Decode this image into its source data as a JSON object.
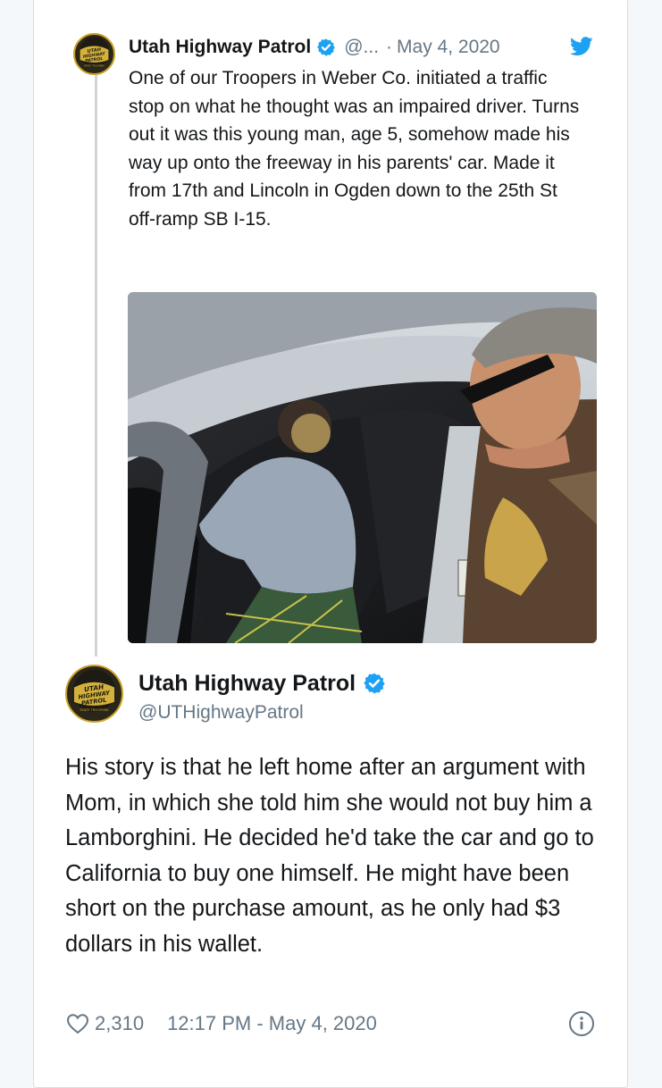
{
  "quoted_tweet": {
    "display_name": "Utah Highway Patrol",
    "handle": "@...",
    "separator": "·",
    "date": "May 4, 2020",
    "text": "One of our Troopers in Weber Co. initiated a traffic stop on what he thought was an impaired driver. Turns out it was this young man, age 5, somehow made his way up onto the freeway in his parents' car. Made it from 17th and Lincoln in Ogden down to the 25th St off-ramp SB I-15.",
    "avatar_icon": "utah-highway-patrol-badge-logo",
    "verified_icon": "verified-badge-icon",
    "source_icon": "twitter-bird-icon"
  },
  "main_tweet": {
    "display_name": "Utah Highway Patrol",
    "handle": "@UTHighwayPatrol",
    "text": "His story is that he left home after an argument with Mom, in which she told him she would not buy him a Lamborghini. He decided he'd take the car and go to California to buy one himself. He might have been short on the purchase amount, as he only had $3 dollars in his wallet.",
    "avatar_icon": "utah-highway-patrol-badge-logo",
    "verified_icon": "verified-badge-icon"
  },
  "footer": {
    "like_icon": "heart-icon",
    "like_count": "2,310",
    "timestamp": "12:17 PM - May 4, 2020",
    "info_icon": "info-icon"
  },
  "logo_text": {
    "line1": "UTAH",
    "line2": "HIGHWAY",
    "line3": "PATROL",
    "line4": "STATE TROOPERS"
  },
  "colors": {
    "verified_blue": "#1da1f2",
    "text_primary": "#14171a",
    "text_secondary": "#657786",
    "badge_gold": "#c9a227"
  }
}
